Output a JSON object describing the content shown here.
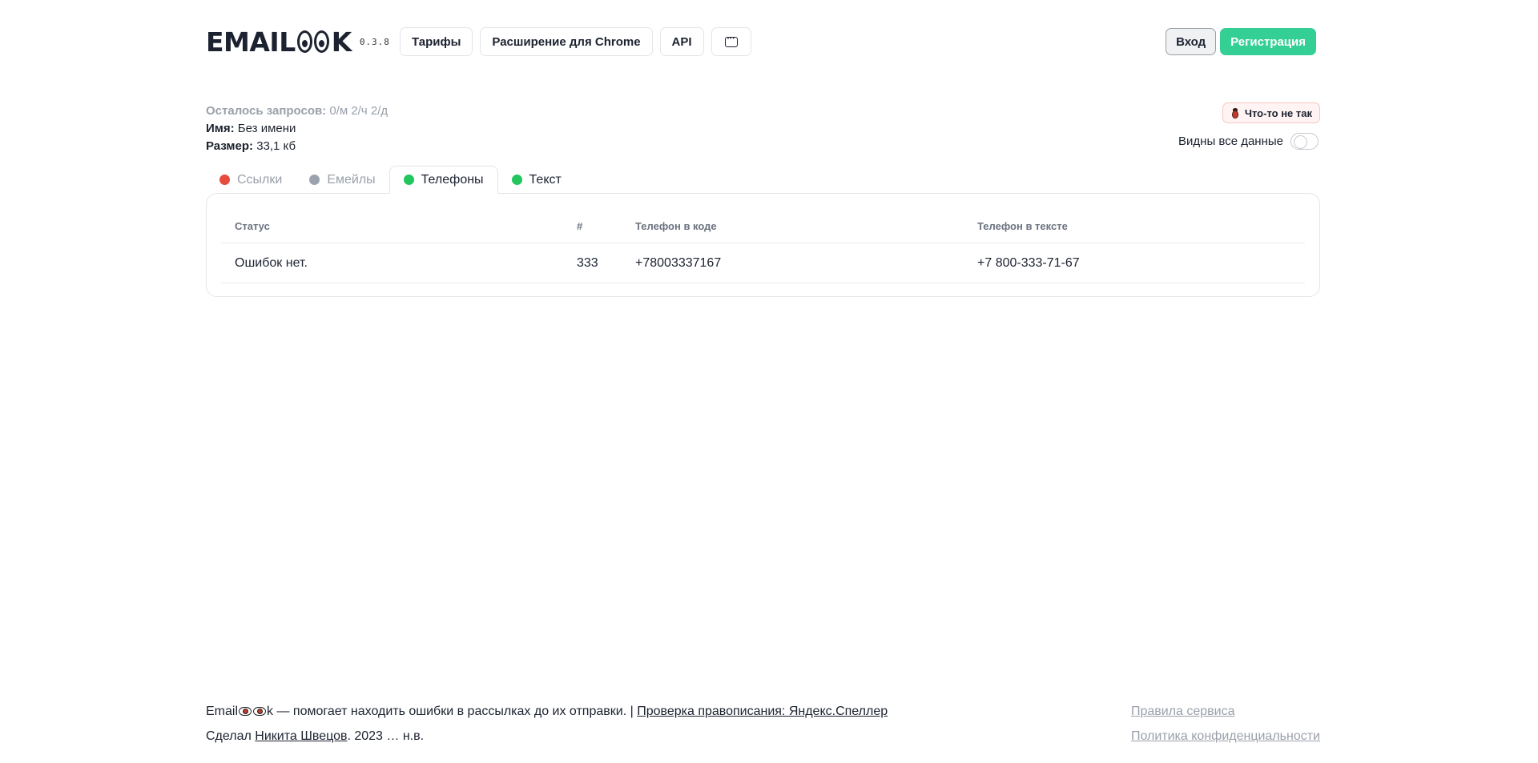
{
  "header": {
    "logo_text_left": "EMAIL",
    "logo_text_right": "K",
    "version": "0.3.8",
    "nav": [
      {
        "label": "Тарифы"
      },
      {
        "label": "Расширение для Chrome"
      },
      {
        "label": "API"
      }
    ],
    "chat_icon": "chat-bubble-icon",
    "login_label": "Вход",
    "register_label": "Регистрация"
  },
  "info": {
    "requests_label": "Осталось запросов:",
    "requests_value": "0/м 2/ч 2/д",
    "name_label": "Имя:",
    "name_value": "Без имени",
    "size_label": "Размер:",
    "size_value": "33,1 кб"
  },
  "report_button": {
    "label": "Что-то не так",
    "icon": "bug-icon"
  },
  "toggle": {
    "label": "Видны все данные",
    "state": "off"
  },
  "tabs": [
    {
      "label": "Ссылки",
      "color": "#e74c3c"
    },
    {
      "label": "Емейлы",
      "color": "#9ca3af"
    },
    {
      "label": "Телефоны",
      "color": "#22c55e",
      "active": true
    },
    {
      "label": "Текст",
      "color": "#22c55e"
    }
  ],
  "table": {
    "columns": [
      "Статус",
      "#",
      "Телефон в коде",
      "Телефон в тексте"
    ],
    "rows": [
      [
        "Ошибок нет.",
        "333",
        "+78003337167",
        "+7 800-333-71-67"
      ]
    ]
  },
  "footer": {
    "brand_left": "Email",
    "brand_right": "k",
    "tagline": " — помогает находить ошибки в рассылках до их отправки. | ",
    "speller_link": "Проверка правописания: Яндекс.Спеллер",
    "made_by_prefix": "Сделал ",
    "author_link": "Никита Швецов",
    "made_by_suffix": ". 2023 … н.в.",
    "rules_link": "Правила сервиса",
    "privacy_link": "Политика конфиденциальности"
  },
  "colors": {
    "accent": "#33cf95",
    "muted": "#9aa0aa",
    "text": "#1c2230"
  }
}
